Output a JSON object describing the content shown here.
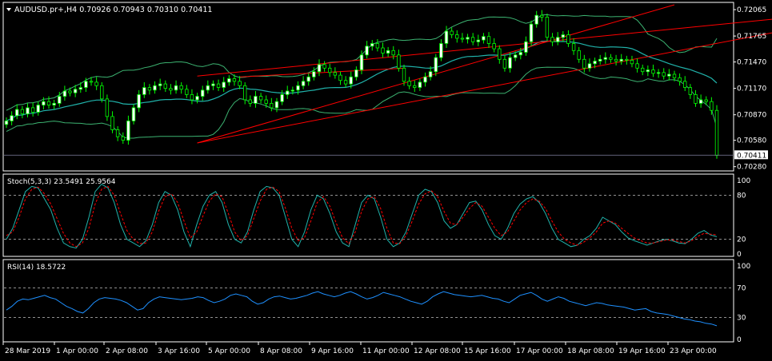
{
  "header": {
    "symbol_line": "AUDUSD.pr+,H4  0.70926 0.70943 0.70310 0.70411"
  },
  "colors": {
    "background": "#000000",
    "frame": "#ffffff",
    "bull_candle": "#ffffff",
    "bear_candle": "#000000",
    "candle_outline": "#00ff00",
    "bollinger": "#3cb371",
    "moving_average": "#20b2aa",
    "channel": "#ff0000",
    "stoch_main": "#20b2aa",
    "stoch_signal": "#ff0000",
    "rsi": "#1e90ff",
    "level_line": "#c0c0c0",
    "price_marker": "#ffffff"
  },
  "current_price_label": "0.70411",
  "chart_data": [
    {
      "type": "candlestick",
      "panel": "price",
      "title": "AUDUSD.pr+,H4",
      "ohlc_last": {
        "open": 0.70926,
        "high": 0.70943,
        "low": 0.7031,
        "close": 0.70411
      },
      "ylim": [
        0.7025,
        0.7212
      ],
      "y_ticks": [
        "0.72065",
        "0.71765",
        "0.71470",
        "0.71170",
        "0.70870",
        "0.70580",
        "0.70280"
      ],
      "y_tick_values": [
        0.72065,
        0.71765,
        0.7147,
        0.7117,
        0.7087,
        0.7058,
        0.7028
      ],
      "x_ticks": [
        "28 Mar 2019",
        "1 Apr 00:00",
        "2 Apr 08:00",
        "3 Apr 16:00",
        "5 Apr 00:00",
        "8 Apr 08:00",
        "9 Apr 16:00",
        "11 Apr 00:00",
        "12 Apr 08:00",
        "15 Apr 16:00",
        "17 Apr 00:00",
        "18 Apr 08:00",
        "19 Apr 16:00",
        "23 Apr 00:00"
      ],
      "closes": [
        0.708,
        0.7086,
        0.7093,
        0.7088,
        0.7095,
        0.709,
        0.7098,
        0.7102,
        0.7098,
        0.71,
        0.7108,
        0.7114,
        0.7112,
        0.7116,
        0.7118,
        0.7125,
        0.7124,
        0.712,
        0.7105,
        0.7085,
        0.707,
        0.7062,
        0.7058,
        0.708,
        0.7095,
        0.711,
        0.7118,
        0.7115,
        0.712,
        0.7122,
        0.7117,
        0.7115,
        0.712,
        0.7116,
        0.711,
        0.7104,
        0.7108,
        0.7115,
        0.712,
        0.7122,
        0.7118,
        0.7124,
        0.7128,
        0.7125,
        0.712,
        0.7104,
        0.71,
        0.7108,
        0.7104,
        0.71,
        0.7095,
        0.7102,
        0.711,
        0.7114,
        0.7115,
        0.712,
        0.7125,
        0.713,
        0.7136,
        0.7144,
        0.714,
        0.7135,
        0.7132,
        0.7126,
        0.7122,
        0.713,
        0.7138,
        0.7155,
        0.7165,
        0.7168,
        0.7163,
        0.7157,
        0.716,
        0.7155,
        0.714,
        0.7125,
        0.712,
        0.7118,
        0.7124,
        0.713,
        0.7136,
        0.7152,
        0.7168,
        0.7182,
        0.7178,
        0.7174,
        0.7173,
        0.7175,
        0.717,
        0.7172,
        0.7176,
        0.7168,
        0.7162,
        0.715,
        0.714,
        0.7152,
        0.7155,
        0.7158,
        0.717,
        0.719,
        0.72,
        0.7198,
        0.7175,
        0.717,
        0.7175,
        0.7178,
        0.7168,
        0.716,
        0.715,
        0.714,
        0.7145,
        0.7148,
        0.715,
        0.7152,
        0.715,
        0.7148,
        0.715,
        0.7149,
        0.7145,
        0.714,
        0.7136,
        0.7138,
        0.7134,
        0.7135,
        0.7131,
        0.7133,
        0.7129,
        0.7125,
        0.7118,
        0.711,
        0.71,
        0.7104,
        0.7102,
        0.7092,
        0.7041
      ]
    },
    {
      "type": "line",
      "panel": "stochastic",
      "title": "Stoch(5,3,3) 23.5491 25.9564",
      "ylim": [
        0,
        100
      ],
      "y_ticks": [
        "100",
        "80",
        "20",
        "0"
      ],
      "y_tick_values": [
        100,
        80,
        20,
        0
      ],
      "levels": [
        80,
        20
      ],
      "series": [
        {
          "name": "Stoch(5,3,3)",
          "last": 23.5491,
          "values": [
            20,
            35,
            60,
            85,
            92,
            90,
            75,
            60,
            35,
            15,
            10,
            8,
            20,
            50,
            85,
            95,
            90,
            70,
            40,
            20,
            15,
            10,
            18,
            40,
            70,
            85,
            80,
            60,
            30,
            10,
            40,
            65,
            80,
            85,
            70,
            40,
            20,
            15,
            30,
            60,
            85,
            92,
            90,
            80,
            50,
            20,
            10,
            30,
            60,
            80,
            75,
            55,
            30,
            15,
            10,
            40,
            70,
            80,
            75,
            50,
            20,
            10,
            15,
            30,
            55,
            80,
            88,
            85,
            70,
            45,
            35,
            40,
            55,
            70,
            72,
            60,
            40,
            25,
            20,
            35,
            55,
            68,
            75,
            78,
            70,
            55,
            35,
            20,
            15,
            10,
            12,
            20,
            25,
            35,
            50,
            45,
            40,
            30,
            22,
            18,
            15,
            12,
            15,
            18,
            20,
            18,
            15,
            14,
            20,
            28,
            32,
            26,
            23.5
          ]
        },
        {
          "name": "signal",
          "last": 25.9564,
          "values": [
            25,
            30,
            50,
            75,
            88,
            91,
            82,
            68,
            48,
            28,
            15,
            10,
            15,
            35,
            68,
            88,
            92,
            80,
            55,
            32,
            20,
            14,
            15,
            30,
            58,
            78,
            82,
            70,
            45,
            22,
            30,
            52,
            72,
            82,
            78,
            55,
            30,
            18,
            25,
            48,
            72,
            88,
            91,
            85,
            62,
            35,
            18,
            22,
            45,
            70,
            78,
            65,
            42,
            22,
            14,
            30,
            58,
            75,
            78,
            62,
            35,
            15,
            14,
            25,
            45,
            68,
            82,
            86,
            78,
            58,
            42,
            40,
            50,
            62,
            70,
            65,
            50,
            35,
            25,
            30,
            45,
            60,
            70,
            75,
            72,
            62,
            45,
            30,
            20,
            15,
            12,
            16,
            22,
            30,
            42,
            45,
            42,
            35,
            28,
            22,
            18,
            15,
            15,
            17,
            19,
            19,
            17,
            15,
            18,
            24,
            28,
            27,
            25.9
          ]
        }
      ]
    },
    {
      "type": "line",
      "panel": "rsi",
      "title": "RSI(14) 18.5722",
      "ylim": [
        0,
        100
      ],
      "y_ticks": [
        "100",
        "70",
        "30",
        "0"
      ],
      "y_tick_values": [
        100,
        70,
        30,
        0
      ],
      "levels": [
        70,
        30
      ],
      "series": [
        {
          "name": "RSI(14)",
          "last": 18.5722,
          "values": [
            40,
            45,
            52,
            55,
            54,
            56,
            58,
            60,
            57,
            55,
            50,
            45,
            42,
            38,
            36,
            42,
            50,
            55,
            57,
            56,
            55,
            53,
            50,
            45,
            40,
            42,
            50,
            55,
            58,
            57,
            56,
            55,
            54,
            55,
            56,
            58,
            57,
            53,
            50,
            52,
            55,
            60,
            62,
            60,
            58,
            52,
            48,
            50,
            55,
            58,
            59,
            57,
            55,
            56,
            58,
            60,
            63,
            65,
            62,
            60,
            58,
            60,
            63,
            65,
            62,
            58,
            55,
            57,
            60,
            64,
            62,
            60,
            58,
            55,
            52,
            50,
            48,
            52,
            58,
            62,
            65,
            63,
            61,
            60,
            59,
            58,
            59,
            60,
            58,
            56,
            55,
            52,
            50,
            55,
            60,
            62,
            64,
            60,
            55,
            52,
            55,
            58,
            56,
            52,
            50,
            48,
            46,
            48,
            50,
            49,
            47,
            46,
            45,
            44,
            42,
            40,
            41,
            42,
            38,
            36,
            35,
            34,
            32,
            30,
            28,
            27,
            25,
            24,
            22,
            21,
            18.6
          ]
        }
      ]
    }
  ]
}
